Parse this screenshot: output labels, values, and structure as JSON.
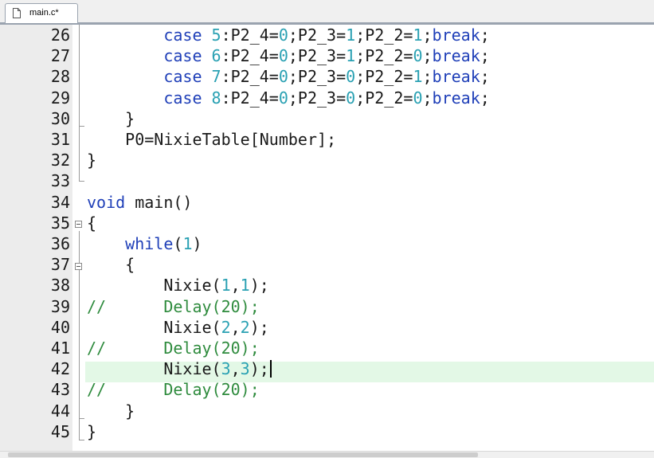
{
  "tab": {
    "label": "main.c*"
  },
  "lines": [
    {
      "n": "26",
      "tokens": [
        [
          "p",
          "        "
        ],
        [
          "kw",
          "case"
        ],
        [
          "p",
          " "
        ],
        [
          "num",
          "5"
        ],
        [
          "p",
          ":P2_4="
        ],
        [
          "num",
          "0"
        ],
        [
          "p",
          ";P2_3="
        ],
        [
          "num",
          "1"
        ],
        [
          "p",
          ";P2_2="
        ],
        [
          "num",
          "1"
        ],
        [
          "p",
          ";"
        ],
        [
          "kw",
          "break"
        ],
        [
          "p",
          ";"
        ]
      ]
    },
    {
      "n": "27",
      "tokens": [
        [
          "p",
          "        "
        ],
        [
          "kw",
          "case"
        ],
        [
          "p",
          " "
        ],
        [
          "num",
          "6"
        ],
        [
          "p",
          ":P2_4="
        ],
        [
          "num",
          "0"
        ],
        [
          "p",
          ";P2_3="
        ],
        [
          "num",
          "1"
        ],
        [
          "p",
          ";P2_2="
        ],
        [
          "num",
          "0"
        ],
        [
          "p",
          ";"
        ],
        [
          "kw",
          "break"
        ],
        [
          "p",
          ";"
        ]
      ]
    },
    {
      "n": "28",
      "tokens": [
        [
          "p",
          "        "
        ],
        [
          "kw",
          "case"
        ],
        [
          "p",
          " "
        ],
        [
          "num",
          "7"
        ],
        [
          "p",
          ":P2_4="
        ],
        [
          "num",
          "0"
        ],
        [
          "p",
          ";P2_3="
        ],
        [
          "num",
          "0"
        ],
        [
          "p",
          ";P2_2="
        ],
        [
          "num",
          "1"
        ],
        [
          "p",
          ";"
        ],
        [
          "kw",
          "break"
        ],
        [
          "p",
          ";"
        ]
      ]
    },
    {
      "n": "29",
      "tokens": [
        [
          "p",
          "        "
        ],
        [
          "kw",
          "case"
        ],
        [
          "p",
          " "
        ],
        [
          "num",
          "8"
        ],
        [
          "p",
          ":P2_4="
        ],
        [
          "num",
          "0"
        ],
        [
          "p",
          ";P2_3="
        ],
        [
          "num",
          "0"
        ],
        [
          "p",
          ";P2_2="
        ],
        [
          "num",
          "0"
        ],
        [
          "p",
          ";"
        ],
        [
          "kw",
          "break"
        ],
        [
          "p",
          ";"
        ]
      ]
    },
    {
      "n": "30",
      "tokens": [
        [
          "p",
          "    }"
        ]
      ]
    },
    {
      "n": "31",
      "tokens": [
        [
          "p",
          "    P0=NixieTable[Number];"
        ]
      ]
    },
    {
      "n": "32",
      "tokens": [
        [
          "p",
          "}"
        ]
      ]
    },
    {
      "n": "33",
      "tokens": []
    },
    {
      "n": "34",
      "tokens": [
        [
          "kw",
          "void"
        ],
        [
          "p",
          " main()"
        ]
      ]
    },
    {
      "n": "35",
      "tokens": [
        [
          "p",
          "{"
        ]
      ]
    },
    {
      "n": "36",
      "tokens": [
        [
          "p",
          "    "
        ],
        [
          "kw",
          "while"
        ],
        [
          "p",
          "("
        ],
        [
          "num",
          "1"
        ],
        [
          "p",
          ")"
        ]
      ]
    },
    {
      "n": "37",
      "tokens": [
        [
          "p",
          "    {"
        ]
      ]
    },
    {
      "n": "38",
      "tokens": [
        [
          "p",
          "        Nixie("
        ],
        [
          "num",
          "1"
        ],
        [
          "p",
          ","
        ],
        [
          "num",
          "1"
        ],
        [
          "p",
          ");"
        ]
      ]
    },
    {
      "n": "39",
      "tokens": [
        [
          "cmt",
          "//      Delay(20);"
        ]
      ]
    },
    {
      "n": "40",
      "tokens": [
        [
          "p",
          "        Nixie("
        ],
        [
          "num",
          "2"
        ],
        [
          "p",
          ","
        ],
        [
          "num",
          "2"
        ],
        [
          "p",
          ");"
        ]
      ]
    },
    {
      "n": "41",
      "tokens": [
        [
          "cmt",
          "//      Delay(20);"
        ]
      ]
    },
    {
      "n": "42",
      "tokens": [
        [
          "p",
          "        Nixie("
        ],
        [
          "num",
          "3"
        ],
        [
          "p",
          ","
        ],
        [
          "num",
          "3"
        ],
        [
          "p",
          ");"
        ]
      ],
      "current": true
    },
    {
      "n": "43",
      "tokens": [
        [
          "cmt",
          "//      Delay(20);"
        ]
      ]
    },
    {
      "n": "44",
      "tokens": [
        [
          "p",
          "    }"
        ]
      ]
    },
    {
      "n": "45",
      "tokens": [
        [
          "p",
          "}"
        ]
      ]
    }
  ]
}
